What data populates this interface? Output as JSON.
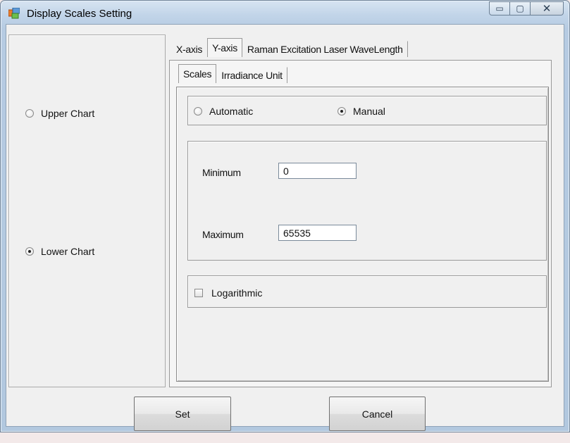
{
  "window": {
    "title": "Display Scales Setting",
    "caption_buttons": {
      "minimize": "▭",
      "maximize": "▢",
      "close": "✕"
    }
  },
  "chart_select": {
    "upper_label": "Upper Chart",
    "lower_label": "Lower Chart",
    "selected": "Lower Chart"
  },
  "outer_tabs": [
    {
      "label": "X-axis",
      "active": false
    },
    {
      "label": "Y-axis",
      "active": true
    },
    {
      "label": "Raman Excitation Laser WaveLength",
      "active": false
    }
  ],
  "inner_tabs": [
    {
      "label": "Scales",
      "active": true
    },
    {
      "label": "Irradiance Unit",
      "active": false
    }
  ],
  "mode": {
    "automatic_label": "Automatic",
    "manual_label": "Manual",
    "selected": "Manual"
  },
  "range": {
    "minimum_label": "Minimum",
    "minimum_value": "0",
    "maximum_label": "Maximum",
    "maximum_value": "65535"
  },
  "logarithmic": {
    "label": "Logarithmic",
    "checked": false
  },
  "buttons": {
    "set": "Set",
    "cancel": "Cancel"
  },
  "icons": {
    "app": "dialog-window-icon",
    "minimize": "minimize-icon",
    "maximize": "maximize-icon",
    "close": "close-icon"
  }
}
